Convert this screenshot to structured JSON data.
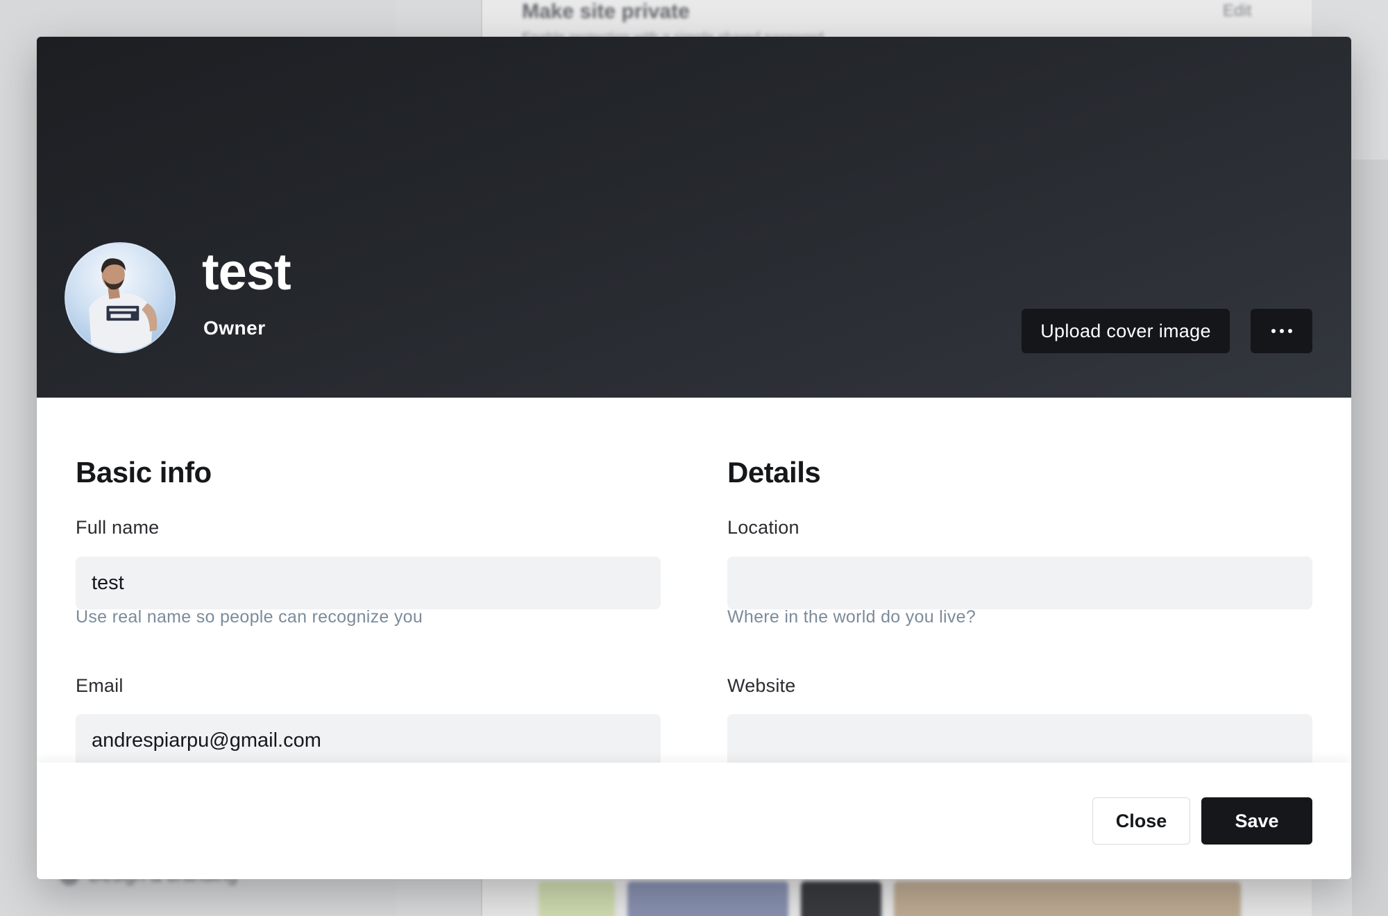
{
  "background": {
    "setting_title": "Make site private",
    "setting_edit": "Edit",
    "setting_desc": "Enable protection with a simple shared password.",
    "sidebar_item": "Design & branding"
  },
  "profile": {
    "name": "test",
    "role": "Owner",
    "upload_cover_label": "Upload cover image",
    "more_icon": "ellipsis-icon"
  },
  "basic_info": {
    "title": "Basic info",
    "full_name": {
      "label": "Full name",
      "value": "test",
      "hint": "Use real name so people can recognize you"
    },
    "email": {
      "label": "Email",
      "value": "andrespiarpu@gmail.com"
    }
  },
  "details": {
    "title": "Details",
    "location": {
      "label": "Location",
      "value": "",
      "hint": "Where in the world do you live?"
    },
    "website": {
      "label": "Website",
      "value": ""
    }
  },
  "footer": {
    "close_label": "Close",
    "save_label": "Save"
  },
  "colors": {
    "cover_dark": "#1c1e22",
    "button_dark": "#151619",
    "input_bg": "#f1f2f4",
    "hint_text": "#7c8b9a"
  }
}
